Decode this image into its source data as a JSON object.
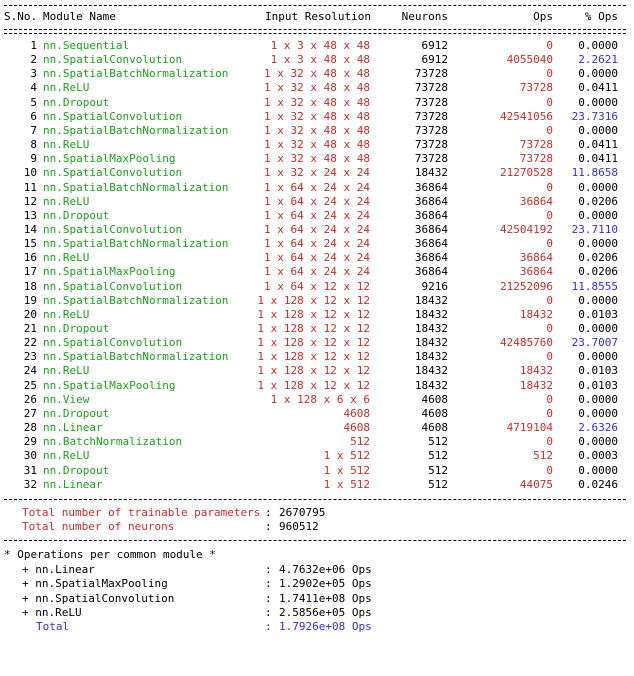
{
  "header": {
    "sno": "S.No.",
    "module": "Module Name",
    "input": "Input Resolution",
    "neurons": "Neurons",
    "ops": "Ops",
    "pct": "% Ops"
  },
  "rows": [
    {
      "n": "1",
      "m": "nn.Sequential",
      "in": "1 x 3 x 48 x 48",
      "neu": "6912",
      "ops": "0",
      "pct": "0.0000",
      "hl": false
    },
    {
      "n": "2",
      "m": "nn.SpatialConvolution",
      "in": "1 x 3 x 48 x 48",
      "neu": "6912",
      "ops": "4055040",
      "pct": "2.2621",
      "hl": true
    },
    {
      "n": "3",
      "m": "nn.SpatialBatchNormalization",
      "in": "1 x 32 x 48 x 48",
      "neu": "73728",
      "ops": "0",
      "pct": "0.0000",
      "hl": false
    },
    {
      "n": "4",
      "m": "nn.ReLU",
      "in": "1 x 32 x 48 x 48",
      "neu": "73728",
      "ops": "73728",
      "pct": "0.0411",
      "hl": false
    },
    {
      "n": "5",
      "m": "nn.Dropout",
      "in": "1 x 32 x 48 x 48",
      "neu": "73728",
      "ops": "0",
      "pct": "0.0000",
      "hl": false
    },
    {
      "n": "6",
      "m": "nn.SpatialConvolution",
      "in": "1 x 32 x 48 x 48",
      "neu": "73728",
      "ops": "42541056",
      "pct": "23.7316",
      "hl": true
    },
    {
      "n": "7",
      "m": "nn.SpatialBatchNormalization",
      "in": "1 x 32 x 48 x 48",
      "neu": "73728",
      "ops": "0",
      "pct": "0.0000",
      "hl": false
    },
    {
      "n": "8",
      "m": "nn.ReLU",
      "in": "1 x 32 x 48 x 48",
      "neu": "73728",
      "ops": "73728",
      "pct": "0.0411",
      "hl": false
    },
    {
      "n": "9",
      "m": "nn.SpatialMaxPooling",
      "in": "1 x 32 x 48 x 48",
      "neu": "73728",
      "ops": "73728",
      "pct": "0.0411",
      "hl": false
    },
    {
      "n": "10",
      "m": "nn.SpatialConvolution",
      "in": "1 x 32 x 24 x 24",
      "neu": "18432",
      "ops": "21270528",
      "pct": "11.8658",
      "hl": true
    },
    {
      "n": "11",
      "m": "nn.SpatialBatchNormalization",
      "in": "1 x 64 x 24 x 24",
      "neu": "36864",
      "ops": "0",
      "pct": "0.0000",
      "hl": false
    },
    {
      "n": "12",
      "m": "nn.ReLU",
      "in": "1 x 64 x 24 x 24",
      "neu": "36864",
      "ops": "36864",
      "pct": "0.0206",
      "hl": false
    },
    {
      "n": "13",
      "m": "nn.Dropout",
      "in": "1 x 64 x 24 x 24",
      "neu": "36864",
      "ops": "0",
      "pct": "0.0000",
      "hl": false
    },
    {
      "n": "14",
      "m": "nn.SpatialConvolution",
      "in": "1 x 64 x 24 x 24",
      "neu": "36864",
      "ops": "42504192",
      "pct": "23.7110",
      "hl": true
    },
    {
      "n": "15",
      "m": "nn.SpatialBatchNormalization",
      "in": "1 x 64 x 24 x 24",
      "neu": "36864",
      "ops": "0",
      "pct": "0.0000",
      "hl": false
    },
    {
      "n": "16",
      "m": "nn.ReLU",
      "in": "1 x 64 x 24 x 24",
      "neu": "36864",
      "ops": "36864",
      "pct": "0.0206",
      "hl": false
    },
    {
      "n": "17",
      "m": "nn.SpatialMaxPooling",
      "in": "1 x 64 x 24 x 24",
      "neu": "36864",
      "ops": "36864",
      "pct": "0.0206",
      "hl": false
    },
    {
      "n": "18",
      "m": "nn.SpatialConvolution",
      "in": "1 x 64 x 12 x 12",
      "neu": "9216",
      "ops": "21252096",
      "pct": "11.8555",
      "hl": true
    },
    {
      "n": "19",
      "m": "nn.SpatialBatchNormalization",
      "in": "1 x 128 x 12 x 12",
      "neu": "18432",
      "ops": "0",
      "pct": "0.0000",
      "hl": false
    },
    {
      "n": "20",
      "m": "nn.ReLU",
      "in": "1 x 128 x 12 x 12",
      "neu": "18432",
      "ops": "18432",
      "pct": "0.0103",
      "hl": false
    },
    {
      "n": "21",
      "m": "nn.Dropout",
      "in": "1 x 128 x 12 x 12",
      "neu": "18432",
      "ops": "0",
      "pct": "0.0000",
      "hl": false
    },
    {
      "n": "22",
      "m": "nn.SpatialConvolution",
      "in": "1 x 128 x 12 x 12",
      "neu": "18432",
      "ops": "42485760",
      "pct": "23.7007",
      "hl": true
    },
    {
      "n": "23",
      "m": "nn.SpatialBatchNormalization",
      "in": "1 x 128 x 12 x 12",
      "neu": "18432",
      "ops": "0",
      "pct": "0.0000",
      "hl": false
    },
    {
      "n": "24",
      "m": "nn.ReLU",
      "in": "1 x 128 x 12 x 12",
      "neu": "18432",
      "ops": "18432",
      "pct": "0.0103",
      "hl": false
    },
    {
      "n": "25",
      "m": "nn.SpatialMaxPooling",
      "in": "1 x 128 x 12 x 12",
      "neu": "18432",
      "ops": "18432",
      "pct": "0.0103",
      "hl": false
    },
    {
      "n": "26",
      "m": "nn.View",
      "in": "1 x 128 x 6 x 6",
      "neu": "4608",
      "ops": "0",
      "pct": "0.0000",
      "hl": false
    },
    {
      "n": "27",
      "m": "nn.Dropout",
      "in": "4608",
      "neu": "4608",
      "ops": "0",
      "pct": "0.0000",
      "hl": false
    },
    {
      "n": "28",
      "m": "nn.Linear",
      "in": "4608",
      "neu": "4608",
      "ops": "4719104",
      "pct": "2.6326",
      "hl": true
    },
    {
      "n": "29",
      "m": "nn.BatchNormalization",
      "in": "512",
      "neu": "512",
      "ops": "0",
      "pct": "0.0000",
      "hl": false
    },
    {
      "n": "30",
      "m": "nn.ReLU",
      "in": "1 x 512",
      "neu": "512",
      "ops": "512",
      "pct": "0.0003",
      "hl": false
    },
    {
      "n": "31",
      "m": "nn.Dropout",
      "in": "1 x 512",
      "neu": "512",
      "ops": "0",
      "pct": "0.0000",
      "hl": false
    },
    {
      "n": "32",
      "m": "nn.Linear",
      "in": "1 x 512",
      "neu": "512",
      "ops": "44075",
      "pct": "0.0246",
      "hl": false
    }
  ],
  "totals": {
    "params_label": "Total number of trainable parameters",
    "params_value": "2670795",
    "neurons_label": "Total number of neurons",
    "neurons_value": "960512"
  },
  "summary": {
    "title": "* Operations per common module *",
    "items": [
      {
        "label": "+ nn.Linear",
        "value": "4.7632e+06 Ops"
      },
      {
        "label": "+ nn.SpatialMaxPooling",
        "value": "1.2902e+05 Ops"
      },
      {
        "label": "+ nn.SpatialConvolution",
        "value": "1.7411e+08 Ops"
      },
      {
        "label": "+ nn.ReLU",
        "value": "2.5856e+05 Ops"
      }
    ],
    "total_label": "Total",
    "total_value": "1.7926e+08 Ops"
  },
  "colors": {
    "module": "#1f9d1f",
    "value": "#c0302a",
    "highlight": "#3333cc",
    "text": "#000000"
  }
}
